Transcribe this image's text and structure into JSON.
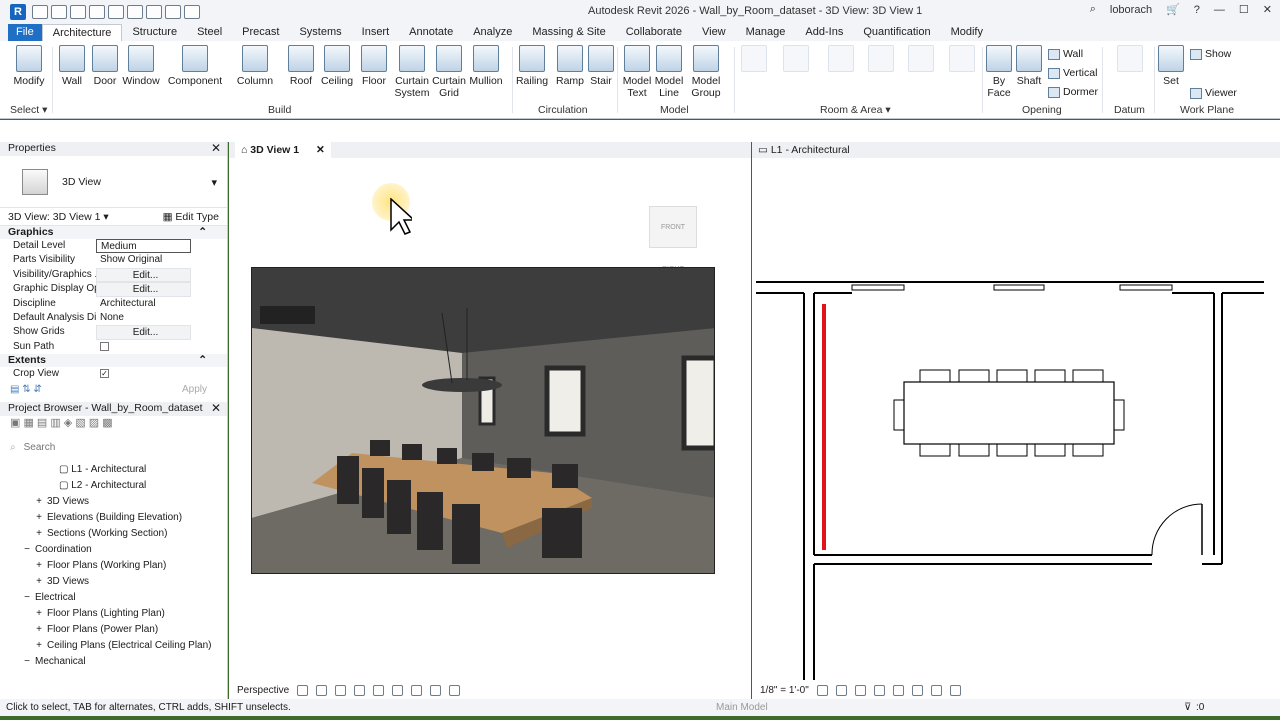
{
  "app": {
    "title": "Autodesk Revit 2026 - Wall_by_Room_dataset - 3D View: 3D View 1",
    "user": "loborach"
  },
  "menu_tabs": [
    "File",
    "Architecture",
    "Structure",
    "Steel",
    "Precast",
    "Systems",
    "Insert",
    "Annotate",
    "Analyze",
    "Massing & Site",
    "Collaborate",
    "View",
    "Manage",
    "Add-Ins",
    "Quantification",
    "Modify"
  ],
  "active_tab": "Architecture",
  "ribbon": {
    "modify": "Modify",
    "build_buttons": [
      "Wall",
      "Door",
      "Window",
      "Component",
      "Column",
      "Roof",
      "Ceiling",
      "Floor"
    ],
    "curtain_system": [
      "Curtain",
      "System"
    ],
    "curtain_grid": [
      "Curtain",
      "Grid"
    ],
    "mullion": "Mullion",
    "railing": "Railing",
    "ramp": "Ramp",
    "stair": "Stair",
    "model_text": [
      "Model",
      "Text"
    ],
    "model_line": [
      "Model",
      "Line"
    ],
    "model_group": [
      "Model",
      "Group"
    ],
    "by_face": [
      "By",
      "Face"
    ],
    "shaft": "Shaft",
    "opening_small": [
      "Wall",
      "Vertical",
      "Dormer"
    ],
    "set": "Set",
    "show": "Show",
    "viewer": "Viewer",
    "panels": {
      "select": "Select",
      "build": "Build",
      "circulation": "Circulation",
      "model": "Model",
      "room_area": "Room & Area",
      "opening": "Opening",
      "datum": "Datum",
      "work_plane": "Work Plane"
    }
  },
  "properties": {
    "title": "Properties",
    "type": "3D View",
    "selector": "3D View: 3D View 1",
    "edit_type": "Edit Type",
    "groups": {
      "graphics": "Graphics",
      "extents": "Extents"
    },
    "rows": [
      {
        "key": "Detail Level",
        "value": "Medium"
      },
      {
        "key": "Parts Visibility",
        "value": "Show Original"
      },
      {
        "key": "Visibility/Graphics ...",
        "value": "Edit..."
      },
      {
        "key": "Graphic Display Op...",
        "value": "Edit..."
      },
      {
        "key": "Discipline",
        "value": "Architectural"
      },
      {
        "key": "Default Analysis Di...",
        "value": "None"
      },
      {
        "key": "Show Grids",
        "value": "Edit..."
      },
      {
        "key": "Sun Path",
        "value": ""
      }
    ],
    "crop_view": "Crop View",
    "apply": "Apply"
  },
  "browser": {
    "title": "Project Browser - Wall_by_Room_dataset",
    "search_placeholder": "Search",
    "items": [
      {
        "label": "L1 - Architectural",
        "level": 3,
        "exp": ""
      },
      {
        "label": "L2 - Architectural",
        "level": 3,
        "exp": ""
      },
      {
        "label": "3D Views",
        "level": 2,
        "exp": "+"
      },
      {
        "label": "Elevations (Building Elevation)",
        "level": 2,
        "exp": "+"
      },
      {
        "label": "Sections (Working Section)",
        "level": 2,
        "exp": "+"
      },
      {
        "label": "Coordination",
        "level": 1,
        "exp": "−"
      },
      {
        "label": "Floor Plans (Working Plan)",
        "level": 2,
        "exp": "+"
      },
      {
        "label": "3D Views",
        "level": 2,
        "exp": "+"
      },
      {
        "label": "Electrical",
        "level": 1,
        "exp": "−"
      },
      {
        "label": "Floor Plans (Lighting Plan)",
        "level": 2,
        "exp": "+"
      },
      {
        "label": "Floor Plans (Power Plan)",
        "level": 2,
        "exp": "+"
      },
      {
        "label": "Ceiling Plans (Electrical Ceiling Plan)",
        "level": 2,
        "exp": "+"
      },
      {
        "label": "Mechanical",
        "level": 1,
        "exp": "−"
      }
    ]
  },
  "views": {
    "view3d_tab": "3D View 1",
    "plan_tab": "L1 - Architectural",
    "perspective": "Perspective",
    "scale": "1/8\" = 1'-0\""
  },
  "status": {
    "hint": "Click to select, TAB for alternates, CTRL adds, SHIFT unselects.",
    "main_model": "Main Model",
    "filter_count": ":0"
  }
}
